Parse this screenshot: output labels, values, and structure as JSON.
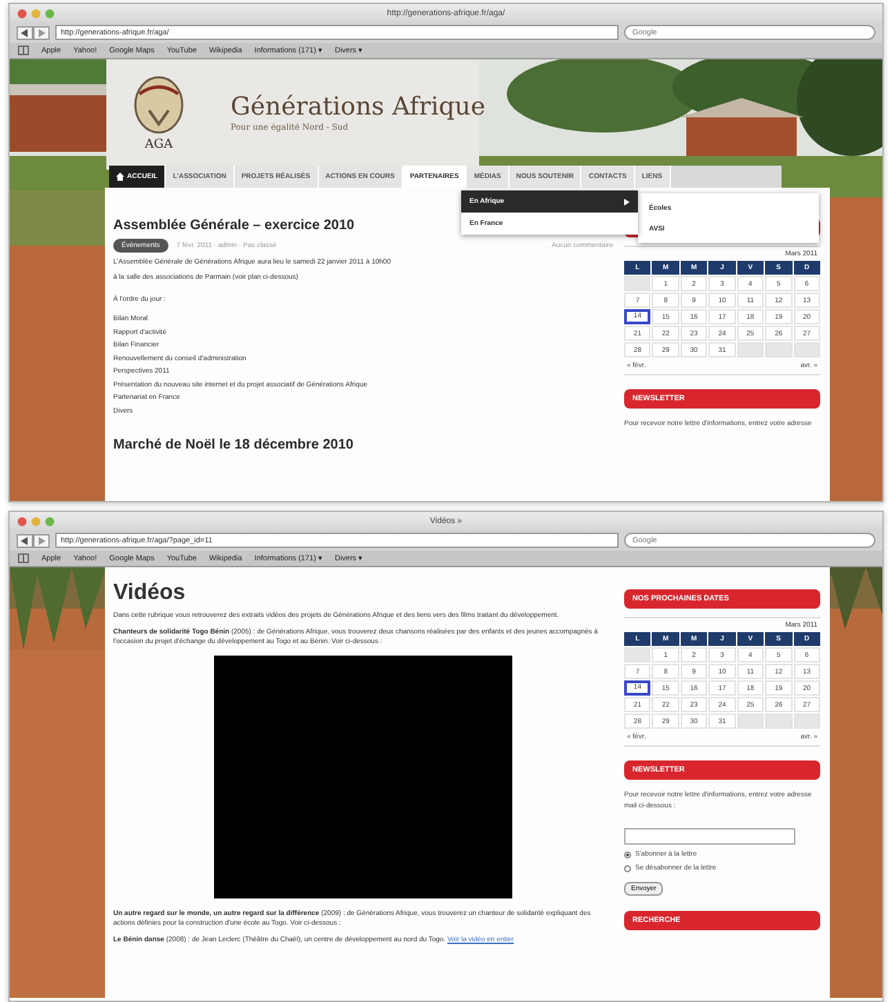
{
  "top_window": {
    "title": "http://generations-afrique.fr/aga/",
    "address": "http://generations-afrique.fr/aga/",
    "search_placeholder": "Google",
    "bookmarks": [
      "Apple",
      "Yahoo!",
      "Google Maps",
      "YouTube",
      "Wikipedia",
      "Informations (171) ▾",
      "Divers ▾"
    ],
    "site": {
      "logo_text": "AGA",
      "name": "Générations Afrique",
      "tagline": "Pour une égalité Nord - Sud"
    },
    "nav": [
      {
        "label": "ACCUEIL",
        "selected": true,
        "open": false
      },
      {
        "label": "L'ASSOCIATION",
        "selected": false,
        "open": false
      },
      {
        "label": "PROJETS RÉALISÉS",
        "selected": false,
        "open": false
      },
      {
        "label": "ACTIONS EN COURS",
        "selected": false,
        "open": false
      },
      {
        "label": "PARTENAIRES",
        "selected": false,
        "open": true
      },
      {
        "label": "MÉDIAS",
        "selected": false,
        "open": false
      },
      {
        "label": "NOUS SOUTENIR",
        "selected": false,
        "open": false
      },
      {
        "label": "CONTACTS",
        "selected": false,
        "open": false
      },
      {
        "label": "LIENS",
        "selected": false,
        "open": false
      }
    ],
    "dropdown": [
      {
        "label": "En Afrique",
        "selected": true,
        "submenu": [
          "Écoles",
          "AVSI"
        ]
      },
      {
        "label": "En France",
        "selected": false
      }
    ],
    "posts": [
      {
        "title": "Assemblée Générale – exercice 2010",
        "category": "Événements",
        "meta": "7 févr. 2011 · admin · Pas classé",
        "comments": "Aucun commentaire",
        "paragraphs": [
          "L'Assemblée Générale de Générations Afrique aura lieu le samedi 22 janvier 2011 à 10h00",
          "à la salle des associations de Parmain (voir plan ci-dessous)",
          "À l'ordre du jour :"
        ],
        "agenda": [
          "Bilan Moral",
          "Rapport d'activité",
          "Bilan Financier",
          "Renouvellement du conseil d'administration",
          "Perspectives 2011",
          "Présentation du nouveau site internet et du projet associatif de Générations Afrique",
          "Partenariat en France",
          "Divers"
        ]
      },
      {
        "title": "Marché de Noël le 18 décembre 2010"
      }
    ],
    "sidebar": {
      "calendar": {
        "month": "Mars 2011",
        "weekdays": [
          "L",
          "M",
          "M",
          "J",
          "V",
          "S",
          "D"
        ],
        "weeks": [
          {
            "days": [
              {
                "day": "1",
                "selected": false
              },
              {
                "day": "2",
                "selected": false
              },
              {
                "day": "3",
                "selected": false
              },
              {
                "day": "4",
                "selected": false
              },
              {
                "day": "5",
                "selected": false
              },
              {
                "day": "6",
                "selected": false
              }
            ]
          },
          {
            "days": [
              {
                "day": "7",
                "selected": false
              },
              {
                "day": "8",
                "selected": false
              },
              {
                "day": "9",
                "selected": false
              },
              {
                "day": "10",
                "selected": false
              },
              {
                "day": "11",
                "selected": false
              },
              {
                "day": "12",
                "selected": false
              },
              {
                "day": "13",
                "selected": false
              }
            ]
          },
          {
            "days": [
              {
                "day": "14",
                "selected": true
              },
              {
                "day": "15",
                "selected": false
              },
              {
                "day": "16",
                "selected": false
              },
              {
                "day": "17",
                "selected": false
              },
              {
                "day": "18",
                "selected": false
              },
              {
                "day": "19",
                "selected": false
              },
              {
                "day": "20",
                "selected": false
              }
            ]
          },
          {
            "days": [
              {
                "day": "21",
                "selected": false
              },
              {
                "day": "22",
                "selected": false
              },
              {
                "day": "23",
                "selected": false
              },
              {
                "day": "24",
                "selected": false
              },
              {
                "day": "25",
                "selected": false
              },
              {
                "day": "26",
                "selected": false
              },
              {
                "day": "27",
                "selected": false
              }
            ]
          },
          {
            "days": [
              {
                "day": "28",
                "selected": false
              },
              {
                "day": "29",
                "selected": false
              },
              {
                "day": "30",
                "selected": false
              },
              {
                "day": "31",
                "selected": false
              }
            ]
          }
        ],
        "previous": "« févr.",
        "next": "avr. »"
      },
      "newsletter": {
        "heading": "NEWSLETTER",
        "text": "Pour recevoir notre lettre d'informations, entrez votre adresse"
      }
    }
  },
  "bottom_window": {
    "title": "Vidéos »",
    "address": "http://generations-afrique.fr/aga/?page_id=11",
    "search_placeholder": "Google",
    "bookmarks": [
      "Apple",
      "Yahoo!",
      "Google Maps",
      "YouTube",
      "Wikipedia",
      "Informations (171) ▾",
      "Divers ▾"
    ],
    "page": {
      "heading": "Vidéos",
      "intro": "Dans cette rubrique vous retrouverez des extraits vidéos des projets de Générations Afrique et des liens vers des films traitant du développement.",
      "entries": [
        {
          "kind": "text",
          "text": "**Chanteurs de solidarité Togo Bénin** (2005) : de Générations Afrique, vous trouverez deux chansons réalisées par des enfants et des jeunes accompagnés à l'occasion du projet d'échange du développement au Togo et au Bénin. Voir ci-dessous :"
        },
        {
          "kind": "video"
        },
        {
          "kind": "text",
          "text": "**Un autre regard sur le monde, un autre regard sur la différence** (2009) : de Générations Afrique, vous trouverez un chanteur de solidarité expliquant des actions définies pour la construction d'une école au Togo. Voir ci-dessous :"
        },
        {
          "kind": "text",
          "text": "**Le Bénin danse** (2008) : de Jean Leclerc (Théâtre du Chaël), un centre de développement au nord du Togo.",
          "link": "Voir la vidéo en entier"
        }
      ]
    },
    "sidebar": {
      "dates_heading": "NOS PROCHAINES DATES",
      "calendar": {
        "month": "Mars 2011",
        "weekdays": [
          "L",
          "M",
          "M",
          "J",
          "V",
          "S",
          "D"
        ],
        "weeks": [
          {
            "days": [
              {
                "day": "1",
                "selected": false
              },
              {
                "day": "2",
                "selected": false
              },
              {
                "day": "3",
                "selected": false
              },
              {
                "day": "4",
                "selected": false
              },
              {
                "day": "5",
                "selected": false
              },
              {
                "day": "6",
                "selected": false
              }
            ]
          },
          {
            "days": [
              {
                "day": "7",
                "selected": false
              },
              {
                "day": "8",
                "selected": false
              },
              {
                "day": "9",
                "selected": false
              },
              {
                "day": "10",
                "selected": false
              },
              {
                "day": "11",
                "selected": false
              },
              {
                "day": "12",
                "selected": false
              },
              {
                "day": "13",
                "selected": false
              }
            ]
          },
          {
            "days": [
              {
                "day": "14",
                "selected": true
              },
              {
                "day": "15",
                "selected": false
              },
              {
                "day": "16",
                "selected": false
              },
              {
                "day": "17",
                "selected": false
              },
              {
                "day": "18",
                "selected": false
              },
              {
                "day": "19",
                "selected": false
              },
              {
                "day": "20",
                "selected": false
              }
            ]
          },
          {
            "days": [
              {
                "day": "21",
                "selected": false
              },
              {
                "day": "22",
                "selected": false
              },
              {
                "day": "23",
                "selected": false
              },
              {
                "day": "24",
                "selected": false
              },
              {
                "day": "25",
                "selected": false
              },
              {
                "day": "26",
                "selected": false
              },
              {
                "day": "27",
                "selected": false
              }
            ]
          },
          {
            "days": [
              {
                "day": "28",
                "selected": false
              },
              {
                "day": "29",
                "selected": false
              },
              {
                "day": "30",
                "selected": false
              },
              {
                "day": "31",
                "selected": false
              }
            ]
          }
        ],
        "previous": "« févr.",
        "next": "avr. »"
      },
      "newsletter": {
        "heading": "NEWSLETTER",
        "text": "Pour recevoir notre lettre d'informations, entrez votre adresse mail ci-dessous :",
        "options": [
          {
            "label": "S'abonner à la lettre",
            "selected": true
          },
          {
            "label": "Se désabonner de la lettre",
            "selected": false
          }
        ],
        "button": "Envoyer"
      },
      "search_heading": "RECHERCHE"
    }
  }
}
